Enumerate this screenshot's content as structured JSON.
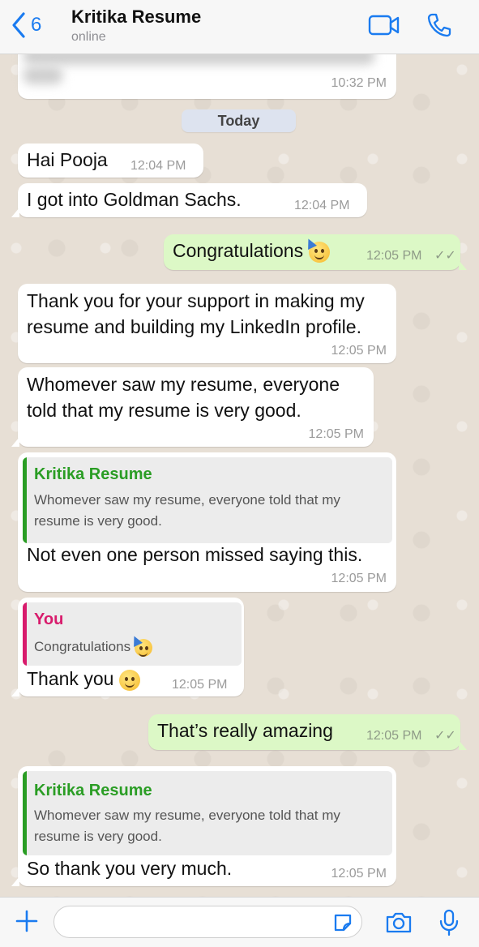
{
  "header": {
    "back_count": "6",
    "contact_name": "Kritika Resume",
    "status": "online"
  },
  "date_divider": "Today",
  "messages": [
    {
      "time": "10:32 PM"
    },
    {
      "text": "Hai Pooja",
      "time": "12:04 PM"
    },
    {
      "text": "I got into Goldman Sachs.",
      "time": "12:04 PM"
    },
    {
      "text": "Congratulations",
      "time": "12:05 PM",
      "emoji": "partying-face"
    },
    {
      "line1": "Thank you for your support in making my",
      "line2": "resume and building my LinkedIn profile.",
      "time": "12:05 PM"
    },
    {
      "line1": "Whomever saw my resume, everyone",
      "line2": "told that my resume is very good.",
      "time": "12:05 PM"
    },
    {
      "quote_author": "Kritika Resume",
      "quote_line1": "Whomever saw my resume, everyone told that my",
      "quote_line2": "resume is very good.",
      "text": "Not even one person missed saying this.",
      "time": "12:05 PM"
    },
    {
      "quote_author": "You",
      "quote_text": "Congratulations",
      "text": "Thank you",
      "time": "12:05 PM",
      "emoji": "smiling-face"
    },
    {
      "text": "That’s really amazing",
      "time": "12:05 PM"
    },
    {
      "quote_author": "Kritika Resume",
      "quote_line1": "Whomever saw my resume, everyone told that my",
      "quote_line2": "resume is very good.",
      "text": "So thank you very much.",
      "time": "12:05 PM"
    }
  ],
  "colors": {
    "accent": "#1a7bf0",
    "incoming": "#ffffff",
    "outgoing": "#dcf8c6",
    "quote_green": "#2a9d24",
    "quote_pink": "#d81b6c"
  },
  "input": {
    "placeholder": ""
  }
}
